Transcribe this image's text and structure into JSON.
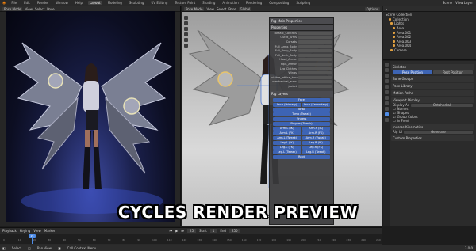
{
  "app": {
    "menu": [
      "File",
      "Edit",
      "Render",
      "Window",
      "Help"
    ],
    "workspaces": [
      "Layout",
      "Modeling",
      "Sculpting",
      "UV Editing",
      "Texture Paint",
      "Shading",
      "Animation",
      "Rendering",
      "Compositing",
      "Scripting"
    ],
    "active_workspace": "Layout",
    "scene": "Scene",
    "view_layer": "View Layer"
  },
  "left_viewport": {
    "mode": "Pose Mode",
    "menus": [
      "View",
      "Select",
      "Pose"
    ]
  },
  "right_viewport": {
    "mode": "Pose Mode",
    "menus": [
      "View",
      "Select",
      "Pose"
    ],
    "transform": "Global",
    "options": "Options"
  },
  "npanel": {
    "title": "Rig Main Properties",
    "subtitle": "Properties",
    "rows": [
      "Breast_Controls",
      "Outfit_Arms",
      "Corsets",
      "Full_Arms_Body",
      "Full_Body_Body",
      "Full_Neck_Body",
      "Hood_Armor",
      "Hips_Armor",
      "Leg_Clothes",
      "Wings",
      "visible_lattice_back",
      "mechanical_arms",
      "jacket"
    ],
    "layers_title": "Rig Layers",
    "layers": [
      "Face",
      "Face (Primary)",
      "Face (Secondary)",
      "Torso",
      "Torso (Tweak)",
      "Fingers",
      "Fingers (Tweak)",
      "Arm.L (IK)",
      "Arm.R (IK)",
      "Arm.L (FK)",
      "Arm.R (FK)",
      "Arm.L (Tweak)",
      "Arm.R (Tweak)",
      "Leg.L (IK)",
      "Leg.R (IK)",
      "Leg.L (FK)",
      "Leg.R (FK)",
      "Leg.L (Tweak)",
      "Leg.R (Tweak)",
      "Root"
    ]
  },
  "outliner": {
    "title": "Scene Collection",
    "items": [
      "Collection",
      "Lights",
      "Area",
      "Area.001",
      "Area.002",
      "Area.003",
      "Area.004",
      "Camera"
    ]
  },
  "properties": {
    "sections": [
      "Skeleton",
      "Pose Position",
      "Rest Position",
      "Bone Groups",
      "Pose Library",
      "Motion Paths",
      "Viewport Display",
      "Inverse Kinematics",
      "Custom Properties"
    ],
    "viewport_rows": [
      "Display As",
      "Names",
      "Shapes",
      "Group Colors",
      "In Front"
    ],
    "display_as": "Octahedral",
    "rig_ui_label": "Rig UI",
    "rig_ui_btn": "Generate"
  },
  "timeline": {
    "menus": [
      "Playback",
      "Keying",
      "View",
      "Marker"
    ],
    "frame": "25",
    "start_label": "Start",
    "start": "1",
    "end_label": "End",
    "end": "250",
    "ticks": [
      "0",
      "10",
      "20",
      "30",
      "40",
      "50",
      "60",
      "70",
      "80",
      "90",
      "100",
      "110",
      "120",
      "130",
      "140",
      "150",
      "160",
      "170",
      "180",
      "190",
      "200",
      "210",
      "220",
      "230",
      "240",
      "250"
    ]
  },
  "status": {
    "left": "Select",
    "middle": "Pan View",
    "right": "Call Context Menu",
    "version": "3.0.0"
  },
  "banner": "CYCLES RENDER PREVIEW"
}
